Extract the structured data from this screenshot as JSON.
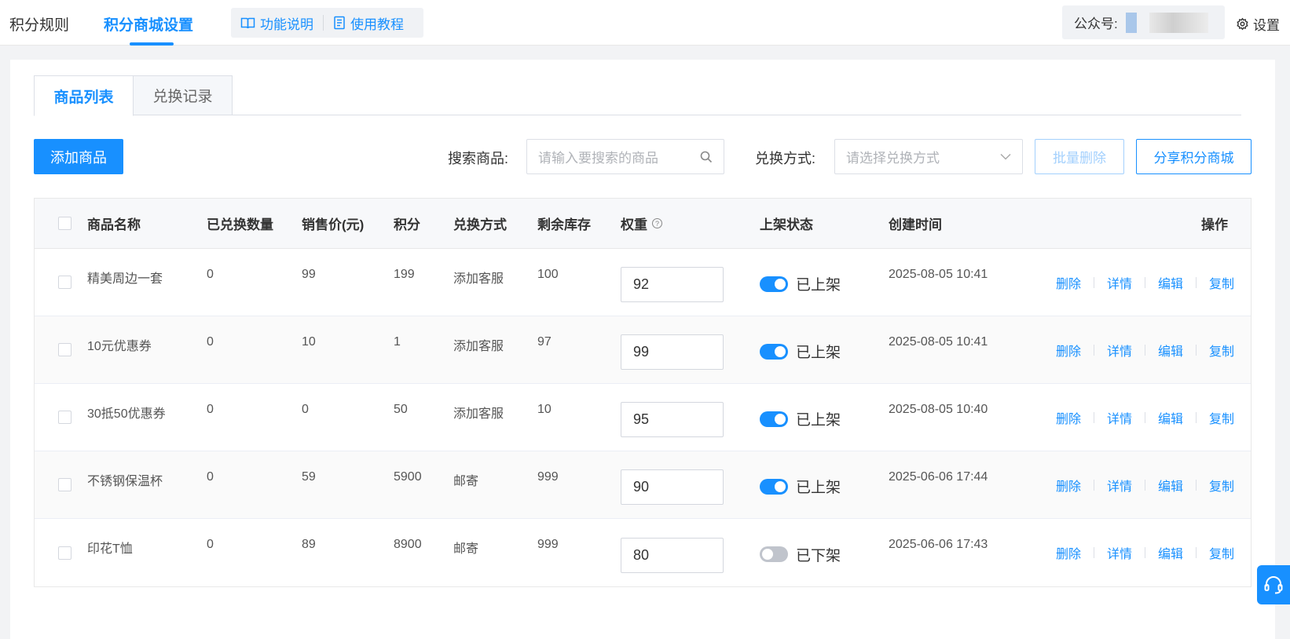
{
  "topbar": {
    "tabs": [
      {
        "label": "积分规则"
      },
      {
        "label": "积分商城设置"
      }
    ],
    "help_links": [
      {
        "label": "功能说明",
        "icon": "book-icon"
      },
      {
        "label": "使用教程",
        "icon": "document-icon"
      }
    ],
    "account_label": "公众号:",
    "settings_label": "设置"
  },
  "subtabs": [
    {
      "label": "商品列表"
    },
    {
      "label": "兑换记录"
    }
  ],
  "toolbar": {
    "add_label": "添加商品",
    "search_label": "搜索商品:",
    "search_placeholder": "请输入要搜索的商品",
    "exchange_label": "兑换方式:",
    "exchange_placeholder": "请选择兑换方式",
    "batch_delete_label": "批量删除",
    "share_label": "分享积分商城"
  },
  "table": {
    "headers": {
      "name": "商品名称",
      "exchanged": "已兑换数量",
      "price": "销售价(元)",
      "points": "积分",
      "method": "兑换方式",
      "stock": "剩余库存",
      "weight": "权重",
      "status": "上架状态",
      "created": "创建时间",
      "actions": "操作"
    },
    "actions": [
      "删除",
      "详情",
      "编辑",
      "复制"
    ],
    "rows": [
      {
        "name": "精美周边一套",
        "exchanged": "0",
        "price": "99",
        "points": "199",
        "method": "添加客服",
        "stock": "100",
        "weight": "92",
        "on": true,
        "status": "已上架",
        "created": "2025-08-05 10:41"
      },
      {
        "name": "10元优惠券",
        "exchanged": "0",
        "price": "10",
        "points": "1",
        "method": "添加客服",
        "stock": "97",
        "weight": "99",
        "on": true,
        "status": "已上架",
        "created": "2025-08-05 10:41"
      },
      {
        "name": "30抵50优惠券",
        "exchanged": "0",
        "price": "0",
        "points": "50",
        "method": "添加客服",
        "stock": "10",
        "weight": "95",
        "on": true,
        "status": "已上架",
        "created": "2025-08-05 10:40"
      },
      {
        "name": "不锈钢保温杯",
        "exchanged": "0",
        "price": "59",
        "points": "5900",
        "method": "邮寄",
        "stock": "999",
        "weight": "90",
        "on": true,
        "status": "已上架",
        "created": "2025-06-06 17:44"
      },
      {
        "name": "印花T恤",
        "exchanged": "0",
        "price": "89",
        "points": "8900",
        "method": "邮寄",
        "stock": "999",
        "weight": "80",
        "on": false,
        "status": "已下架",
        "created": "2025-06-06 17:43"
      }
    ]
  },
  "colors": {
    "accent": "#1890ff",
    "toggle_off": "#c0c4cc"
  }
}
